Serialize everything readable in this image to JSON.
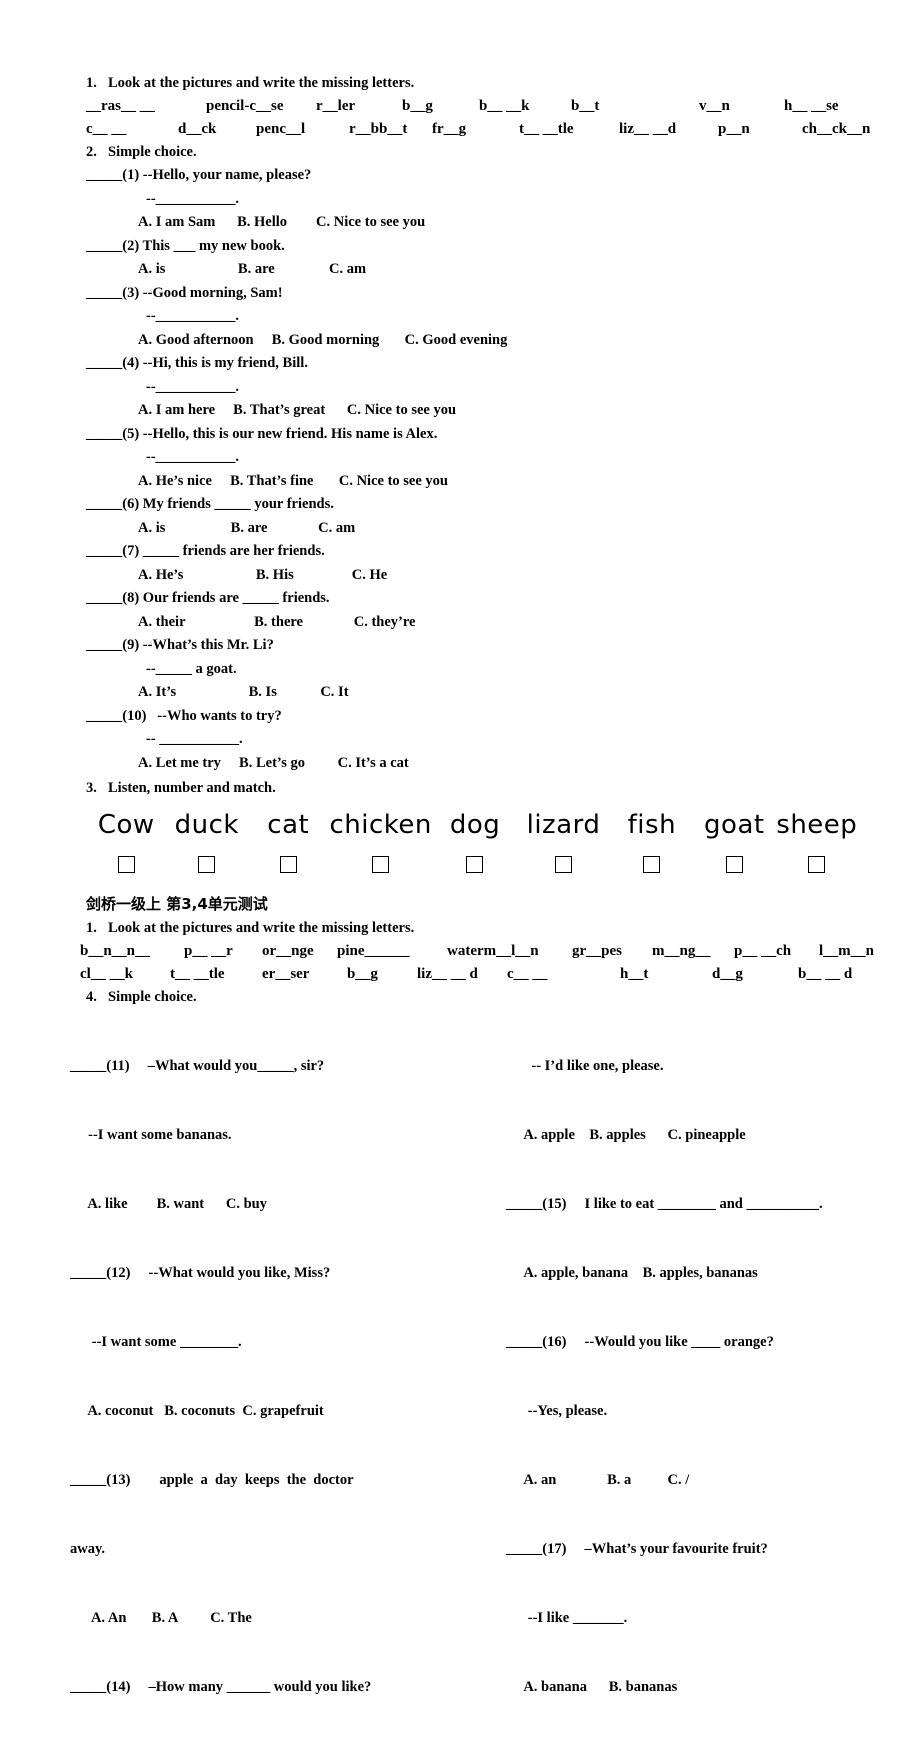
{
  "document": {
    "title": "剑桥一级上 第3,4单元测试"
  },
  "section1": {
    "number": "1.",
    "heading": "Look at the pictures and write the missing letters.",
    "row1": [
      "__ras__ __",
      "pencil-c__se",
      "r__ler",
      "b__g",
      "b__ __k",
      "b__t",
      "v__n",
      "h__ __se"
    ],
    "row2": [
      "c__ __",
      "d__ck",
      "penc__l",
      "r__bb__t",
      "fr__g",
      "t__ __tle",
      "liz__ __d",
      "p__n",
      "ch__ck__n"
    ]
  },
  "section2": {
    "number": "2.",
    "heading": "Simple choice.",
    "questions": [
      {
        "blank": "_____",
        "num": "(1)",
        "stem": "--Hello, your name, please?",
        "reply": "--___________.",
        "options": "A. I am Sam      B. Hello        C. Nice to see you"
      },
      {
        "blank": "_____",
        "num": "(2)",
        "stem": "This ___ my new book.",
        "reply": "",
        "options": "A. is                    B. are               C. am"
      },
      {
        "blank": "_____",
        "num": "(3)",
        "stem": "--Good morning, Sam!",
        "reply": "--___________.",
        "options": "A. Good afternoon     B. Good morning       C. Good evening"
      },
      {
        "blank": "_____",
        "num": "(4)",
        "stem": "--Hi, this is my friend, Bill.",
        "reply": "--___________.",
        "options": "A. I am here     B. That’s great      C. Nice to see you"
      },
      {
        "blank": "_____",
        "num": "(5)",
        "stem": "--Hello, this is our new friend. His name is Alex.",
        "reply": "--___________.",
        "options": "A. He’s nice     B. That’s fine       C. Nice to see you"
      },
      {
        "blank": "_____",
        "num": "(6)",
        "stem": "My friends _____ your friends.",
        "reply": "",
        "options": "A. is                  B. are              C. am"
      },
      {
        "blank": "_____",
        "num": "(7)",
        "stem": "_____ friends are her friends.",
        "reply": "",
        "options": "A. He’s                    B. His                C. He"
      },
      {
        "blank": "_____",
        "num": "(8)",
        "stem": "Our friends are _____ friends.",
        "reply": "",
        "options": "A. their                   B. there              C. they’re"
      },
      {
        "blank": "_____",
        "num": "(9)",
        "stem": "--What’s this Mr. Li?",
        "reply": "--_____ a goat.",
        "options": "A. It’s                    B. Is            C. It"
      },
      {
        "blank": "_____",
        "num": "(10)",
        "stem": "  --Who wants to try?",
        "reply": "-- ___________.",
        "options": "A. Let me try     B. Let’s go         C. It’s a cat"
      }
    ]
  },
  "section3": {
    "number": "3.",
    "heading": "Listen, number and match.",
    "animals": [
      "Cow",
      "duck",
      "cat",
      "chicken",
      "dog",
      "lizard",
      "fish",
      "goat",
      "sheep"
    ],
    "checkbox_count": 9
  },
  "section4_letters": {
    "number": "1.",
    "heading": "Look at the pictures and write the missing letters.",
    "row1": [
      "b__n__n__",
      "p__ __r",
      "or__nge",
      "pine______",
      "waterm__l__n",
      "gr__pes",
      "m__ng__",
      "p__ __ch",
      "l__m__n"
    ],
    "row2": [
      "cl__ __k",
      "t__ __tle",
      "er__ser",
      "b__g",
      "liz__ __ d",
      "c__ __",
      "h__t",
      "d__g",
      "b__ __ d"
    ]
  },
  "section4": {
    "number": "4.",
    "heading": "Simple choice.",
    "left_column": [
      {
        "text": "_____(11)     –What would you_____, sir?"
      },
      {
        "text": "     --I want some bananas."
      },
      {
        "text": "     A. like        B. want      C. buy"
      },
      {
        "text": "_____(12)     --What would you like, Miss?"
      },
      {
        "text": "      --I want some ________."
      },
      {
        "text": "     A. coconut   B. coconuts  C. grapefruit"
      },
      {
        "text": "_____(13)        apple  a  day  keeps  the  doctor"
      },
      {
        "text": "away."
      },
      {
        "text": "      A. An       B. A         C. The"
      },
      {
        "text": "_____(14)     –How many ______ would you like?"
      }
    ],
    "right_column": [
      {
        "text": "       -- I’d like one, please."
      },
      {
        "text": "     A. apple    B. apples      C. pineapple"
      },
      {
        "text": "_____(15)     I like to eat ________ and __________."
      },
      {
        "text": "     A. apple, banana    B. apples, bananas"
      },
      {
        "text": "_____(16)     --Would you like ____ orange?"
      },
      {
        "text": "      --Yes, please."
      },
      {
        "text": "     A. an              B. a          C. /"
      },
      {
        "text": "_____(17)     –What’s your favourite fruit?"
      },
      {
        "text": "      --I like _______."
      },
      {
        "text": "     A. banana      B. bananas"
      }
    ]
  }
}
